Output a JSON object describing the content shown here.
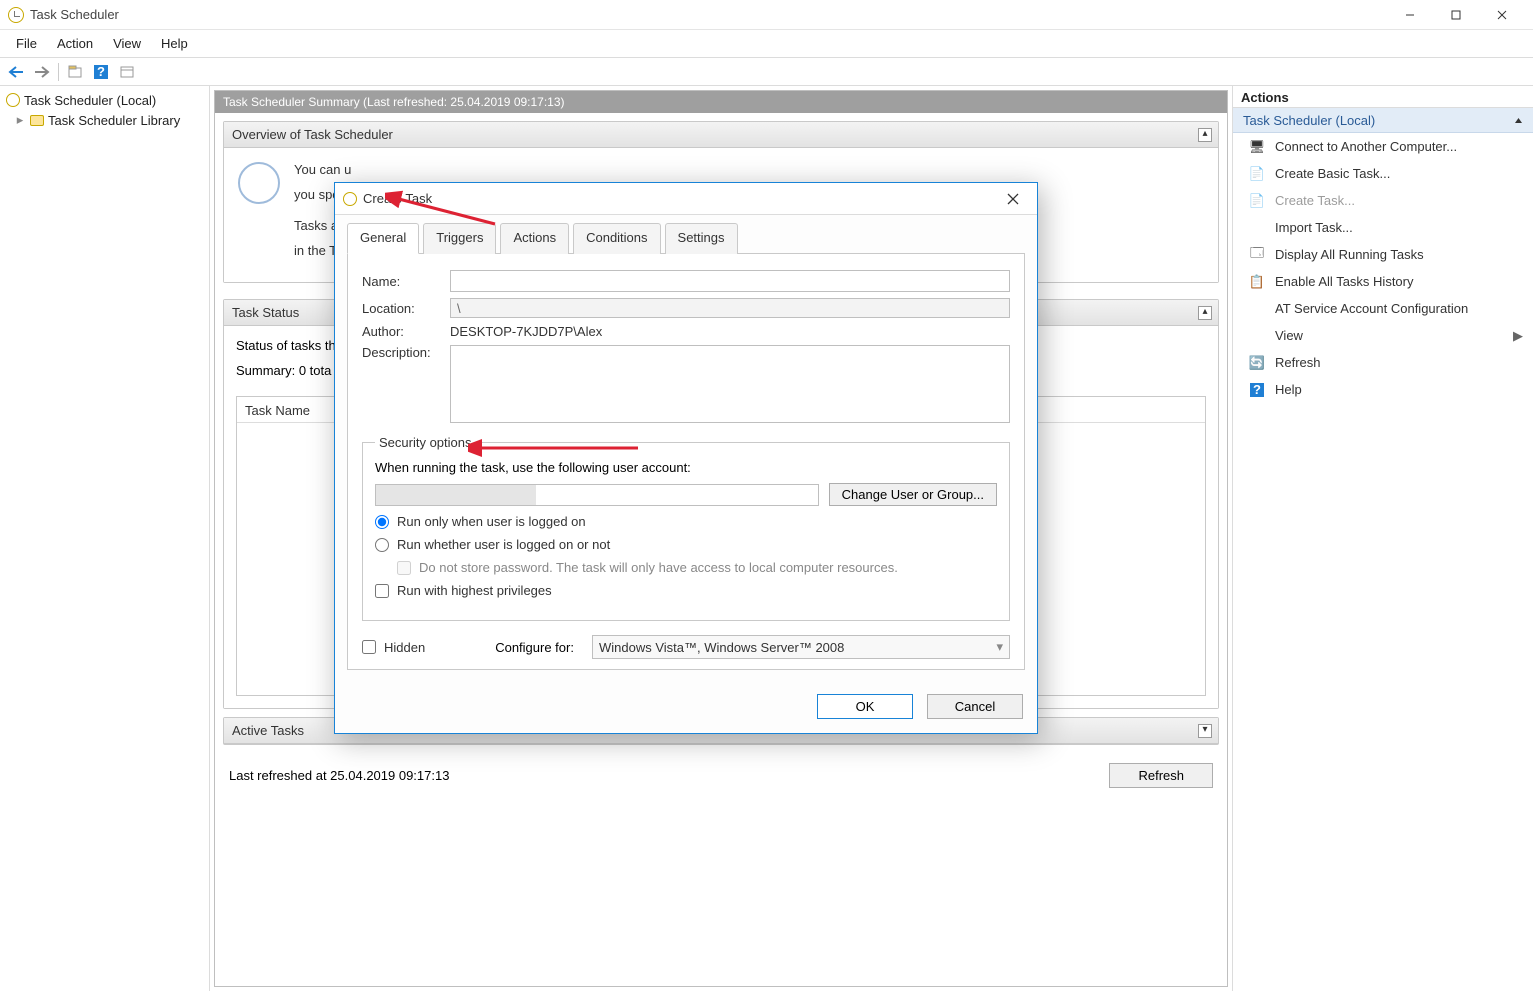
{
  "window_title": "Task Scheduler",
  "menu": {
    "file": "File",
    "action": "Action",
    "view": "View",
    "help": "Help"
  },
  "tree": {
    "root": "Task Scheduler (Local)",
    "library": "Task Scheduler Library"
  },
  "summary_header": "Task Scheduler Summary (Last refreshed: 25.04.2019 09:17:13)",
  "overview": {
    "title": "Overview of Task Scheduler",
    "line1": "You can u",
    "line2": "you speci",
    "line3": "Tasks are",
    "line4": "in the Tas"
  },
  "task_status": {
    "title": "Task Status",
    "status_label": "Status of tasks th",
    "summary_label": "Summary: 0 tota",
    "col_task_name": "Task Name"
  },
  "active_tasks": {
    "title": "Active Tasks"
  },
  "last_refreshed": "Last refreshed at 25.04.2019 09:17:13",
  "refresh_btn": "Refresh",
  "actions": {
    "title": "Actions",
    "section": "Task Scheduler (Local)",
    "items": {
      "connect": "Connect to Another Computer...",
      "create_basic": "Create Basic Task...",
      "create_task": "Create Task...",
      "import_task": "Import Task...",
      "display_running": "Display All Running Tasks",
      "enable_history": "Enable All Tasks History",
      "at_service": "AT Service Account Configuration",
      "view": "View",
      "refresh": "Refresh",
      "help": "Help"
    }
  },
  "dialog": {
    "title": "Create Task",
    "tabs": {
      "general": "General",
      "triggers": "Triggers",
      "actions": "Actions",
      "conditions": "Conditions",
      "settings": "Settings"
    },
    "name_label": "Name:",
    "name_value": "",
    "location_label": "Location:",
    "location_value": "\\",
    "author_label": "Author:",
    "author_value": "DESKTOP-7KJDD7P\\Alex",
    "description_label": "Description:",
    "description_value": "",
    "security_legend": "Security options",
    "security_desc": "When running the task, use the following user account:",
    "change_user_btn": "Change User or Group...",
    "radio_logged_on": "Run only when user is logged on",
    "radio_logged_off": "Run whether user is logged on or not",
    "check_no_password": "Do not store password.  The task will only have access to local computer resources.",
    "check_highest_priv": "Run with highest privileges",
    "check_hidden": "Hidden",
    "configure_for_label": "Configure for:",
    "configure_for_value": "Windows Vista™, Windows Server™ 2008",
    "ok_btn": "OK",
    "cancel_btn": "Cancel"
  }
}
